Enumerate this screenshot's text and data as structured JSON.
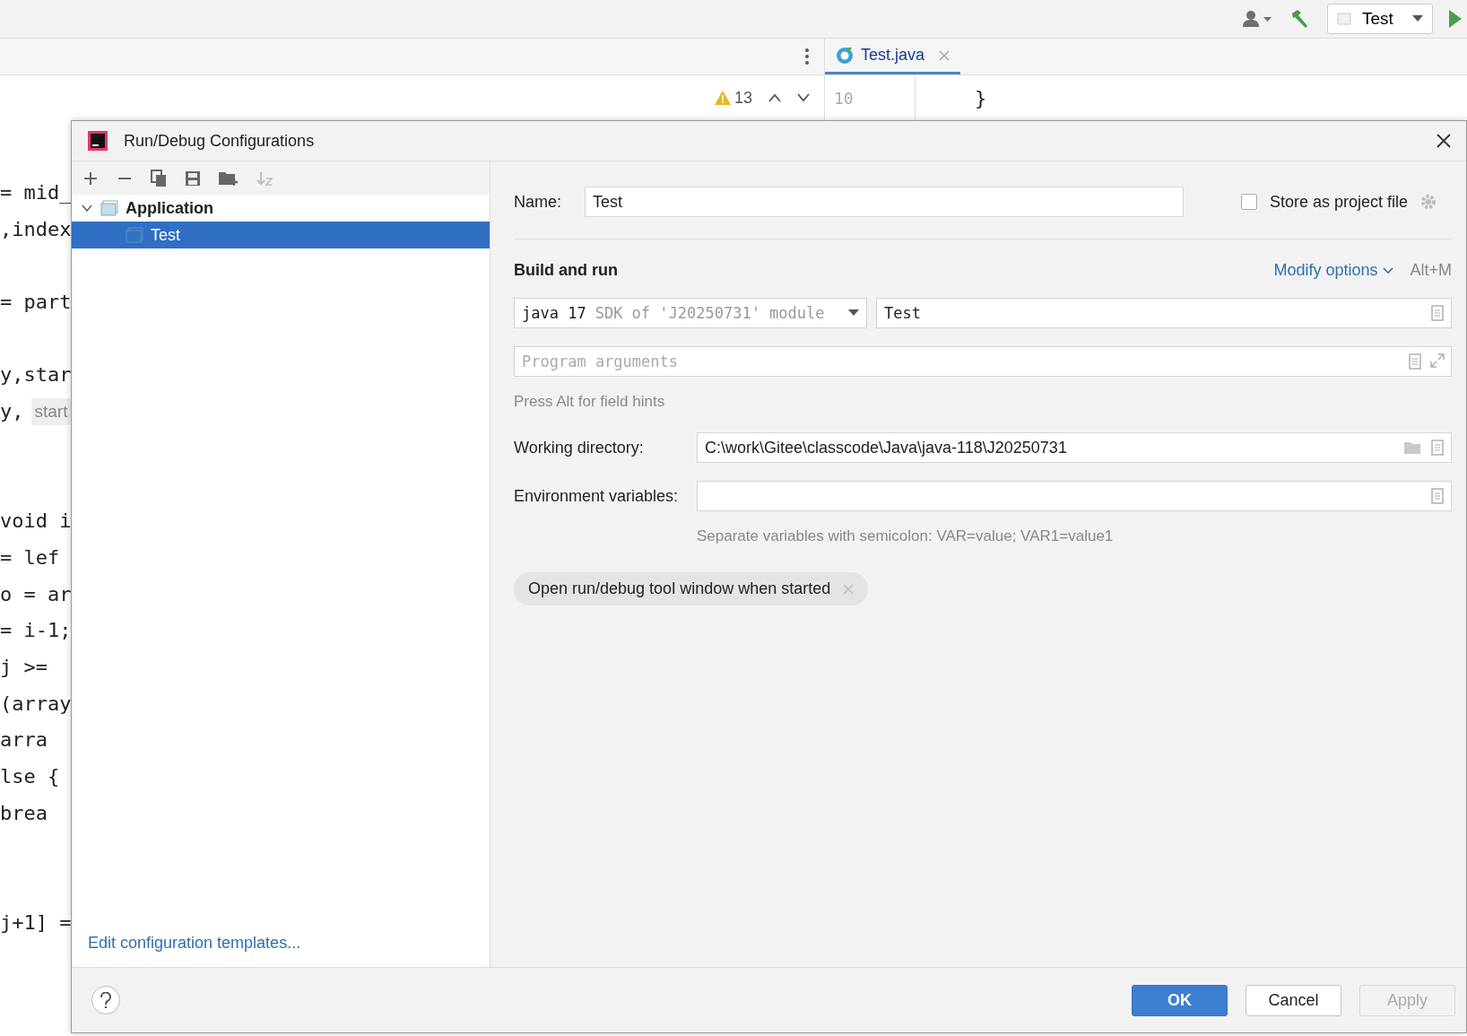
{
  "toolbar": {
    "run_config": "Test"
  },
  "editor_tab": {
    "label": "Test.java",
    "selected": true
  },
  "editor_status": {
    "warnings": "13",
    "line_number": "10",
    "code_text": "}"
  },
  "code_lines": [
    {
      "kind": "code",
      "text": "= mid_"
    },
    {
      "kind": "code",
      "text": ",index"
    },
    {
      "kind": "blank"
    },
    {
      "kind": "code",
      "text": "= part"
    },
    {
      "kind": "blank"
    },
    {
      "kind": "code",
      "text": "y,star"
    },
    {
      "kind": "code",
      "text": "y,",
      "hint": "start"
    },
    {
      "kind": "blank"
    },
    {
      "kind": "blank"
    },
    {
      "kind": "code",
      "text": "void i"
    },
    {
      "kind": "code",
      "text": "= lef"
    },
    {
      "kind": "code",
      "text": "o = ar"
    },
    {
      "kind": "code",
      "text": "= i-1;"
    },
    {
      "kind": "code",
      "text": "j >="
    },
    {
      "kind": "code",
      "text": "(array"
    },
    {
      "kind": "code",
      "text": "arra"
    },
    {
      "kind": "code",
      "text": "lse {"
    },
    {
      "kind": "code",
      "text": "brea"
    },
    {
      "kind": "blank"
    },
    {
      "kind": "blank"
    },
    {
      "kind": "code",
      "text": "j+1] ="
    }
  ],
  "dialog": {
    "title": "Run/Debug Configurations",
    "tree": [
      {
        "label": "Application",
        "expanded": true,
        "selected": false,
        "children": [
          {
            "label": "Test",
            "selected": true
          }
        ]
      }
    ],
    "templates_link": "Edit configuration templates...",
    "name_label": "Name:",
    "name_value": "Test",
    "store_checkbox": {
      "label": "Store as project file",
      "checked": false
    },
    "section_title": "Build and run",
    "modify_options": "Modify options",
    "modify_shortcut": "Alt+M",
    "jdk": {
      "main": "java 17",
      "detail": "SDK of 'J20250731' module"
    },
    "main_class": "Test",
    "program_args_placeholder": "Program arguments",
    "field_hint": "Press Alt for field hints",
    "working_dir": {
      "label": "Working directory:",
      "value": "C:\\work\\Gitee\\classcode\\Java\\java-118\\J20250731"
    },
    "env_vars": {
      "label": "Environment variables:"
    },
    "env_hint": "Separate variables with semicolon: VAR=value; VAR1=value1",
    "chips": [
      "Open run/debug tool window when started"
    ],
    "buttons": [
      {
        "label": "OK",
        "kind": "primary",
        "disabled": false
      },
      {
        "label": "Cancel",
        "kind": "normal",
        "disabled": false
      },
      {
        "label": "Apply",
        "kind": "normal",
        "disabled": true
      }
    ]
  }
}
